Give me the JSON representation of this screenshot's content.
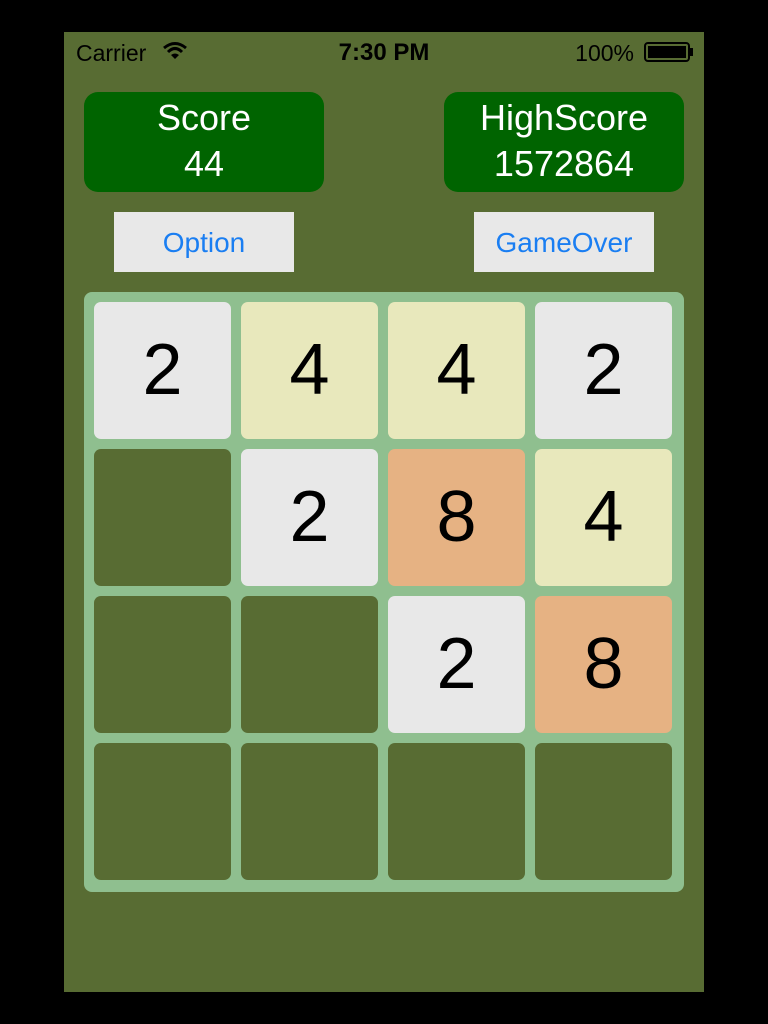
{
  "status_bar": {
    "carrier": "Carrier",
    "time": "7:30 PM",
    "battery": "100%"
  },
  "score": {
    "label": "Score",
    "value": "44"
  },
  "highscore": {
    "label": "HighScore",
    "value": "1572864"
  },
  "buttons": {
    "option": "Option",
    "gameover": "GameOver"
  },
  "colors": {
    "background": "#586c33",
    "score_box": "#006400",
    "board": "#8fbf8f",
    "empty": "#586c33",
    "tile_2": "#e8e8e8",
    "tile_4": "#e8e8bc",
    "tile_8": "#e6b283",
    "button_text": "#1a7ef2"
  },
  "board": {
    "rows": [
      [
        "2",
        "4",
        "4",
        "2"
      ],
      [
        "",
        "2",
        "8",
        "4"
      ],
      [
        "",
        "",
        "2",
        "8"
      ],
      [
        "",
        "",
        "",
        ""
      ]
    ]
  }
}
